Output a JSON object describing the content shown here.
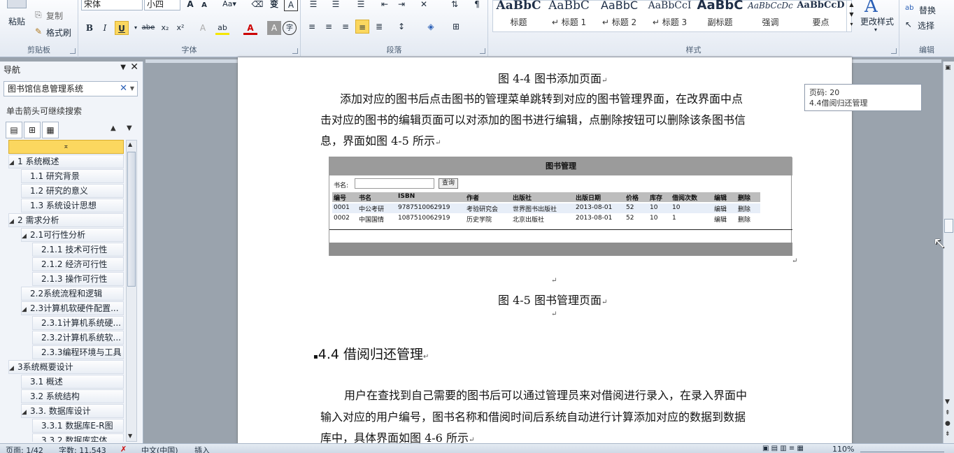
{
  "ribbon": {
    "clipboard": {
      "paste": "粘贴",
      "copy": "复制",
      "format_painter": "格式刷",
      "group": "剪贴板"
    },
    "font": {
      "name": "宋体",
      "size": "小四",
      "group": "字体"
    },
    "paragraph": {
      "group": "段落"
    },
    "styles": {
      "group": "样式",
      "tiles": [
        {
          "preview": "AaBbC",
          "name": "标题"
        },
        {
          "preview": "AaBbC",
          "name": "↵ 标题 1"
        },
        {
          "preview": "AaBbC",
          "name": "↵ 标题 2"
        },
        {
          "preview": "AaBbCcI",
          "name": "↵ 标题 3"
        },
        {
          "preview": "AaBbC",
          "name": "副标题"
        },
        {
          "preview": "AaBbCcDc",
          "name": "强调"
        },
        {
          "preview": "AaBbCcD",
          "name": "要点"
        }
      ],
      "change_styles": "更改样式"
    },
    "editing": {
      "replace": "替换",
      "select": "选择",
      "group": "编辑"
    }
  },
  "nav": {
    "title": "导航",
    "search_value": "图书馆信息管理系统",
    "hint": "单击箭头可继续搜索",
    "items": [
      {
        "label": "1 系统概述",
        "toggle": "◢"
      },
      {
        "label": "1.1 研究背景",
        "toggle": ""
      },
      {
        "label": "1.2 研究的意义",
        "toggle": ""
      },
      {
        "label": "1.3 系统设计思想",
        "toggle": ""
      },
      {
        "label": "2 需求分析",
        "toggle": "◢"
      },
      {
        "label": "2.1可行性分析",
        "toggle": "◢"
      },
      {
        "label": "2.1.1 技术可行性",
        "toggle": ""
      },
      {
        "label": "2.1.2 经济可行性",
        "toggle": ""
      },
      {
        "label": "2.1.3 操作可行性",
        "toggle": ""
      },
      {
        "label": "2.2系统流程和逻辑",
        "toggle": ""
      },
      {
        "label": "2.3计算机软硬件配置...",
        "toggle": "◢"
      },
      {
        "label": "2.3.1计算机系统硬...",
        "toggle": ""
      },
      {
        "label": "2.3.2计算机系统软...",
        "toggle": ""
      },
      {
        "label": "2.3.3编程环境与工具",
        "toggle": ""
      },
      {
        "label": "3系统概要设计",
        "toggle": "◢"
      },
      {
        "label": "3.1 概述",
        "toggle": ""
      },
      {
        "label": "3.2 系统结构",
        "toggle": ""
      },
      {
        "label": "3.3. 数据库设计",
        "toggle": "◢"
      },
      {
        "label": "3.3.1 数据库E-R图",
        "toggle": ""
      },
      {
        "label": "3.3.2 数据库实体",
        "toggle": ""
      }
    ]
  },
  "doc": {
    "fig44_caption": "图 4-4 图书添加页面",
    "para1": [
      "添加对应的图书后点击图书的管理菜单跳转到对应的图书管理界面，在改界面中点",
      "击对应的图书的编辑页面可以对添加的图书进行编辑，点删除按钮可以删除该条图书信",
      "息，界面如图 4-5 所示"
    ],
    "fig45_caption": "图 4-5 图书管理页面",
    "heading": "4.4 借阅归还管理",
    "para2": [
      "用户在查找到自己需要的图书后可以通过管理员来对借阅进行录入，在录入界面中",
      "输入对应的用户编号，图书名称和借阅时间后系统自动进行计算添加对应的数据到数据",
      "库中，具体界面如图 4-6 所示"
    ],
    "para_mark": "↵"
  },
  "screenshot": {
    "title": "图书管理",
    "search_label": "书名:",
    "search_button": "查询",
    "columns": [
      "编号",
      "书名",
      "ISBN",
      "作者",
      "出版社",
      "出版日期",
      "价格",
      "库存",
      "借阅次数",
      "编辑",
      "删除"
    ],
    "rows": [
      [
        "0001",
        "中公考研",
        "9787510062919",
        "考验研究会",
        "世界图书出版社",
        "2013-08-01",
        "52",
        "10",
        "10",
        "编辑",
        "删除"
      ],
      [
        "0002",
        "中国国情",
        "1087510062919",
        "历史学院",
        "北京出版社",
        "2013-08-01",
        "52",
        "10",
        "1",
        "编辑",
        "删除"
      ]
    ]
  },
  "tooltip": {
    "line1": "页码: 20",
    "line2": "4.4借阅归还管理"
  },
  "status": {
    "page": "页面: 1/42",
    "words": "字数: 11,543",
    "lang": "中文(中国)",
    "insert": "插入",
    "zoom": "110%"
  }
}
